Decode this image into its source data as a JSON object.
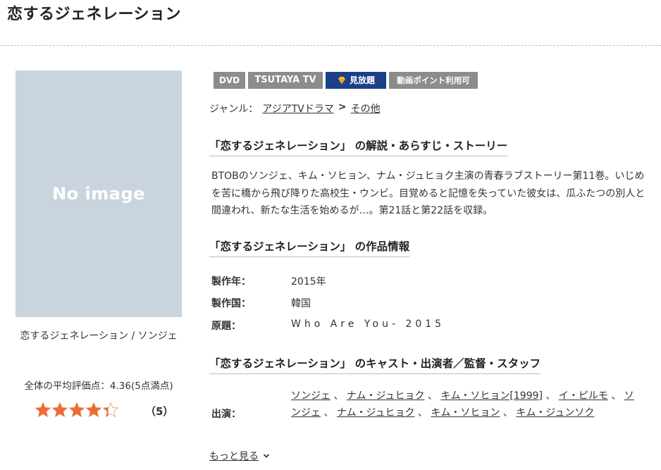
{
  "page": {
    "title": "恋するジェネレーション"
  },
  "poster": {
    "placeholder_text": "No image"
  },
  "caption": "恋するジェネレーション / ソンジェ",
  "rating": {
    "average_text": "全体の平均評価点：4.36(5点満点)",
    "stars_value": 4.36,
    "stars_max": 5,
    "count_text": "（5）"
  },
  "badges": {
    "dvd": "DVD",
    "tsutaya_tv": "TSUTAYA TV",
    "mihodai": "見放題",
    "point": "動画ポイント利用可"
  },
  "genre": {
    "label": "ジャンル：",
    "primary": "アジアTVドラマ",
    "separator": ">",
    "secondary": "その他"
  },
  "sections": {
    "synopsis_heading": "「恋するジェネレーション」 の解説・あらすじ・ストーリー",
    "synopsis_text": "BTOBのソンジェ、キム・ソヒョン、ナム・ジュヒョク主演の青春ラブストーリー第11巻。いじめを苦に橋から飛び降りた高校生・ウンビ。目覚めると記憶を失っていた彼女は、瓜ふたつの別人と間違われ、新たな生活を始めるが…。第21話と第22話を収録。",
    "info_heading": "「恋するジェネレーション」 の作品情報",
    "cast_heading": "「恋するジェネレーション」 のキャスト・出演者／監督・スタッフ"
  },
  "info": {
    "year_label": "製作年：",
    "year_value": "2015年",
    "country_label": "製作国：",
    "country_value": "韓国",
    "original_label": "原題：",
    "original_value": "Who Are You- 2015"
  },
  "cast": {
    "label": "出演：",
    "names": [
      "ソンジェ",
      "ナム・ジュヒョク",
      "キム・ソヒョン[1999]",
      "イ・ピルモ",
      "ソンジェ",
      "ナム・ジュヒョク",
      "キム・ソヒョン",
      "キム・ジュンソク"
    ],
    "delimiter": "、"
  },
  "more_link": "もっと見る",
  "colors": {
    "badge_gray": "#8c8c8c",
    "badge_blue": "#1c3f87",
    "star": "#f06a35",
    "poster_bg": "#c9d4de"
  }
}
